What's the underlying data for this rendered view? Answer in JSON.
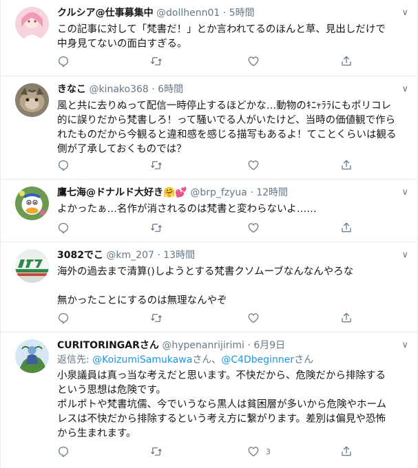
{
  "tweets": [
    {
      "name": "クルシア@仕事募集中",
      "handle": "@dollhenn01",
      "time": "5時間",
      "lines": [
        "この記事に対して「梵書だ！」とか言われてるのほんと草、見出しだけで",
        "中身見てないの面白すぎる。"
      ]
    },
    {
      "name": "きなこ",
      "handle": "@kinako368",
      "time": "6時間",
      "lines": [
        "風と共に去りぬって配信一時停止するほどかな…動物のｷﾆｬﾗﾗにもポリコレ",
        "的に誤りだから梵書しろ！って騒いでる人がいたけど、当時の価値観で作ら",
        "れたものだから今観ると違和感を感じる描写もあるよ！てことくらいは観る",
        "側が了承しておくものでは？"
      ]
    },
    {
      "name": "鷹七海@ドナルド大好き🤗💕",
      "handle": "@brp_fzyua",
      "time": "12時間",
      "lines": [
        "よかったぁ…名作が消されるのは梵書と変わらないよ……"
      ]
    },
    {
      "name": "3082でこ",
      "handle": "@km_207",
      "time": "13時間",
      "lines": [
        "海外の過去まで清算()しようとする梵書クソムーブなんなんやろな",
        "",
        "無かったことにするのは無理なんやぞ"
      ]
    },
    {
      "name": "CURITORINGARさん",
      "handle": "@hypenanrijirimi",
      "time": "6月9日",
      "reply_prefix": "返信先:",
      "reply_user1": "@KoizumiSamukawa",
      "reply_san1": "さん、",
      "reply_user2": "@C4Dbeginner",
      "reply_san2": "さん",
      "lines": [
        "小泉議員は真っ当な考えだと思います。不快だから、危険だから排除する",
        "という思想は危険です。",
        "ポルポトや梵書坑儒、今でいうなら黒人は貧困層が多いから危険やホーム",
        "レスは不快だから排除するという考え方に繋がります。差別は偏見や恐怖",
        "から生まれます。"
      ],
      "like_count": "3"
    }
  ],
  "dot": "·",
  "caret": "∨",
  "colors": {
    "text": "#14171a",
    "muted": "#657786",
    "link": "#1b95e0",
    "border": "#e6ecf0"
  }
}
